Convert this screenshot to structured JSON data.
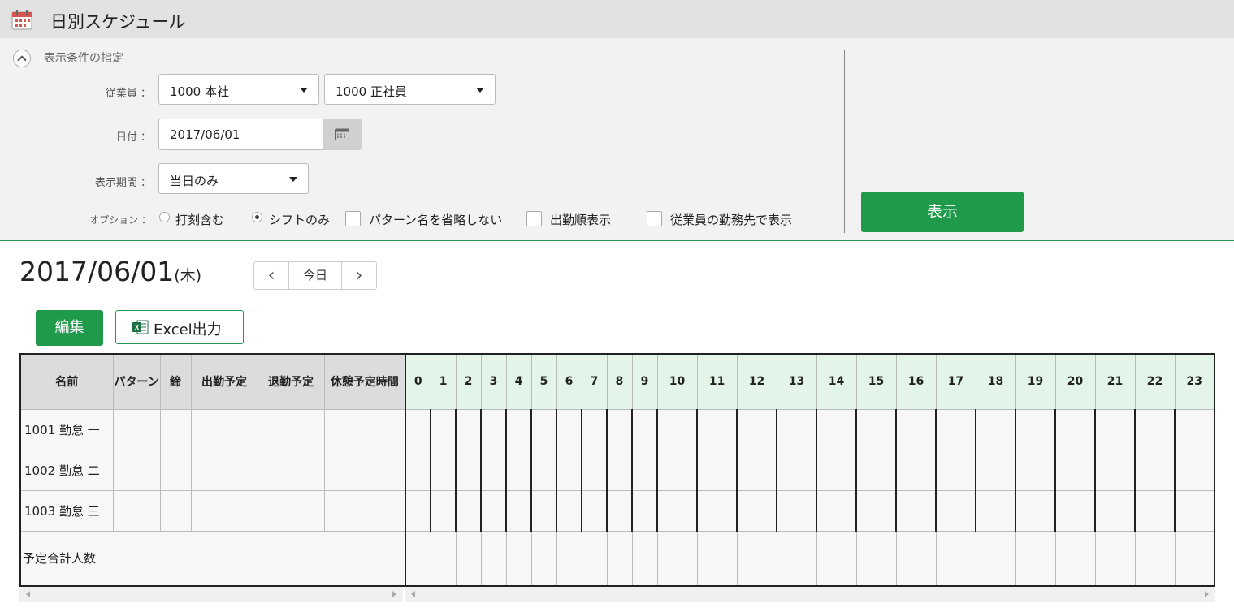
{
  "header": {
    "title": "日別スケジュール",
    "icon": "calendar-icon"
  },
  "conditions": {
    "title": "表示条件の指定",
    "employee_label": "従業員 ：",
    "employee_org": "1000 本社",
    "employee_type": "1000 正社員",
    "date_label": "日付 ：",
    "date_value": "2017/06/01",
    "period_label": "表示期間 ：",
    "period_value": "当日のみ",
    "options_label": "オプション ：",
    "options": {
      "radio_stamp": "打刻含む",
      "radio_shift": "シフトのみ",
      "check_pattern": "パターン名を省略しない",
      "check_order": "出勤順表示",
      "check_workplace": "従業員の勤務先で表示"
    },
    "show_button": "表示"
  },
  "schedule": {
    "date": "2017/06/01",
    "weekday": "(木)",
    "prev": "‹",
    "today": "今日",
    "next": "›",
    "edit_button": "編集",
    "excel_button": "Excel出力",
    "columns": [
      "名前",
      "パターン",
      "締",
      "出勤予定",
      "退勤予定",
      "休憩予定時間"
    ],
    "hours": [
      "0",
      "1",
      "2",
      "3",
      "4",
      "5",
      "6",
      "7",
      "8",
      "9",
      "10",
      "11",
      "12",
      "13",
      "14",
      "15",
      "16",
      "17",
      "18",
      "19",
      "20",
      "21",
      "22",
      "23"
    ],
    "rows": [
      {
        "name": "1001 勤怠 一"
      },
      {
        "name": "1002 勤怠 二"
      },
      {
        "name": "1003 勤怠 三"
      }
    ],
    "total_label": "予定合計人数"
  },
  "colors": {
    "accent": "#1f9a4b",
    "hour_header": "#e3f4e8",
    "header_bg": "#e2e2e2"
  }
}
